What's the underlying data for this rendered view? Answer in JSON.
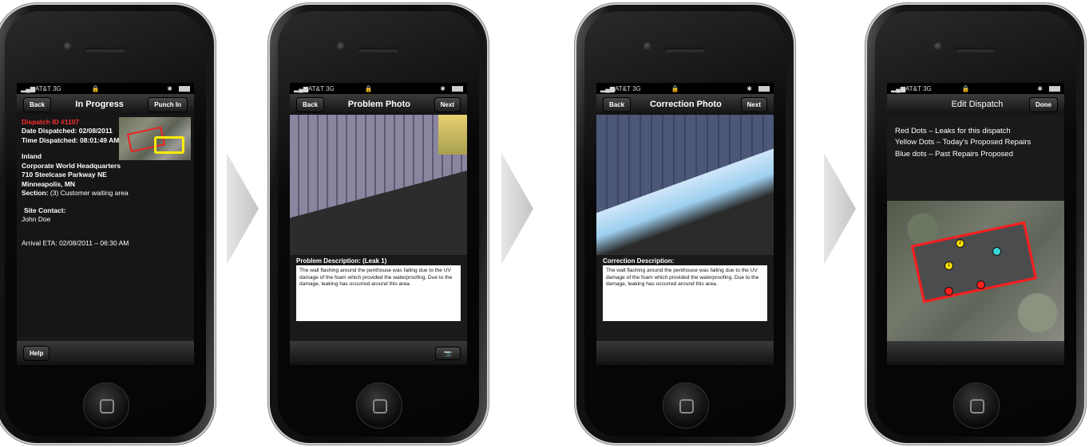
{
  "screens": [
    {
      "status": {
        "carrier": "AT&T",
        "network": "3G"
      },
      "nav": {
        "back": "Back",
        "title": "In Progress",
        "right": "Punch In"
      },
      "dispatch_id": "Dispatch ID #1107",
      "date_dispatched": "Date Dispatched: 02/08/2011",
      "time_dispatched": "Time Dispatched: 08:01:49 AM",
      "address": [
        "Inland",
        "Corporate World Headquarters",
        "710 Steelcase Parkway NE",
        "Minneapolis, MN"
      ],
      "section_label": "Section:",
      "section_value": "(3) Customer waiting area",
      "site_contact_label": "Site Contact:",
      "site_contact_name": "John Doe",
      "arrival_eta": "Arrival ETA: 02/08/2011 – 06:30 AM",
      "bottom": {
        "help": "Help"
      }
    },
    {
      "status": {
        "carrier": "AT&T",
        "network": "3G"
      },
      "nav": {
        "back": "Back",
        "title": "Problem Photo",
        "right": "Next"
      },
      "desc_label": "Problem Description: (Leak 1)",
      "desc_text": "The wall flashing around the penthouse was failing due to the UV damage of the foam which provided the waterproofing. Due to the damage, leaking has occurred around this area."
    },
    {
      "status": {
        "carrier": "AT&T",
        "network": "3G"
      },
      "nav": {
        "back": "Back",
        "title": "Correction Photo",
        "right": "Next"
      },
      "desc_label": "Correction Description:",
      "desc_text": "The wall flashing around the penthouse was failing due to the UV damage of the foam which provided the waterproofing. Due to the damage, leaking has occurred around this area."
    },
    {
      "status": {
        "carrier": "AT&T",
        "network": "3G"
      },
      "nav": {
        "title": "Edit Dispatch",
        "right": "Done"
      },
      "legend": [
        "Red Dots – Leaks for this dispatch",
        "Yellow Dots – Today's Proposed Repairs",
        "Blue dots – Past Repairs Proposed"
      ],
      "map_dots": [
        {
          "color": "#ffe000",
          "label": "2"
        },
        {
          "color": "#ffe000",
          "label": "1"
        },
        {
          "color": "#39d6d6",
          "label": ""
        },
        {
          "color": "#ff2020",
          "label": ""
        },
        {
          "color": "#ff2020",
          "label": ""
        }
      ]
    }
  ],
  "colors": {
    "accent_red": "#ff3030",
    "highlight_yellow": "#ffeb00"
  }
}
